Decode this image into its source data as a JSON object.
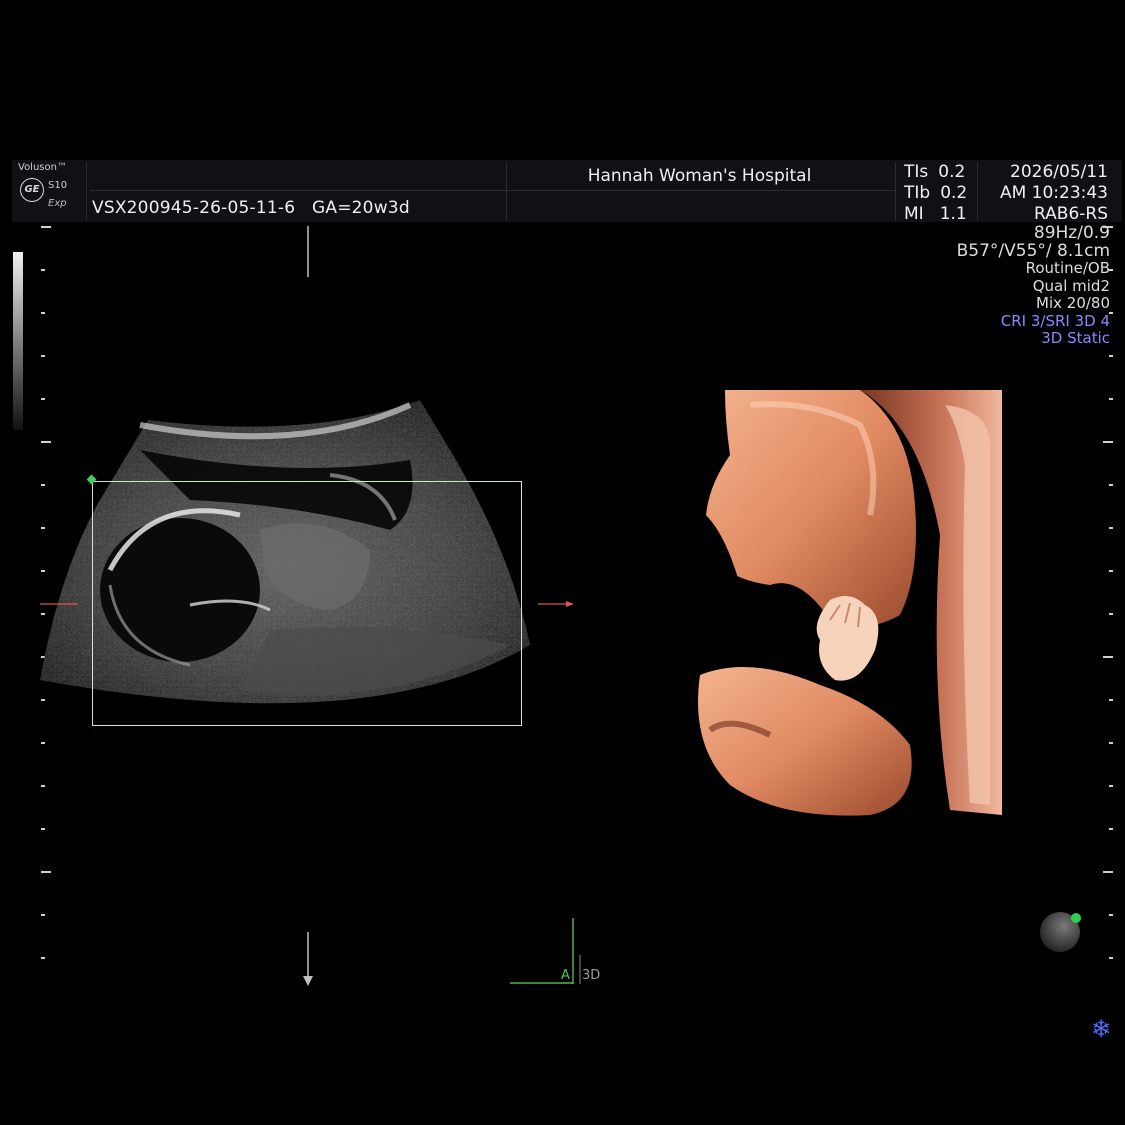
{
  "header": {
    "brand": "Voluson™",
    "model": "S10",
    "edition": "Exp",
    "logo": "GE",
    "patient_line": "VSX200945-26-05-11-6   GA=20w3d",
    "hospital": "Hannah Woman's Hospital",
    "indices": [
      {
        "label": "TIs",
        "value": "0.2"
      },
      {
        "label": "TIb",
        "value": "0.2"
      },
      {
        "label": "MI",
        "value": "1.1"
      }
    ],
    "date": "2026/05/11",
    "time": "AM 10:23:43",
    "probe": "RAB6-RS"
  },
  "params": {
    "frame_rate": "89Hz/0.9",
    "angles": "B57°/V55°/ 8.1cm",
    "preset": "Routine/OB",
    "quality": "Qual mid2",
    "mix": "Mix 20/80",
    "cri_sri": "CRI 3/SRI 3D 4",
    "mode": "3D Static"
  },
  "labels": {
    "axis_a": "A",
    "axis_3d": "3D"
  },
  "icons": {
    "freeze": "snowflake-icon",
    "orientation": "orientation-ball-icon",
    "logo": "ge-logo-icon"
  },
  "colors": {
    "mode_text": "#8d86ff",
    "roi_box": "#cfe8cf",
    "render_skin": "#e8906a",
    "axis_a": "#54c454",
    "freeze_icon": "#4f6dff"
  }
}
